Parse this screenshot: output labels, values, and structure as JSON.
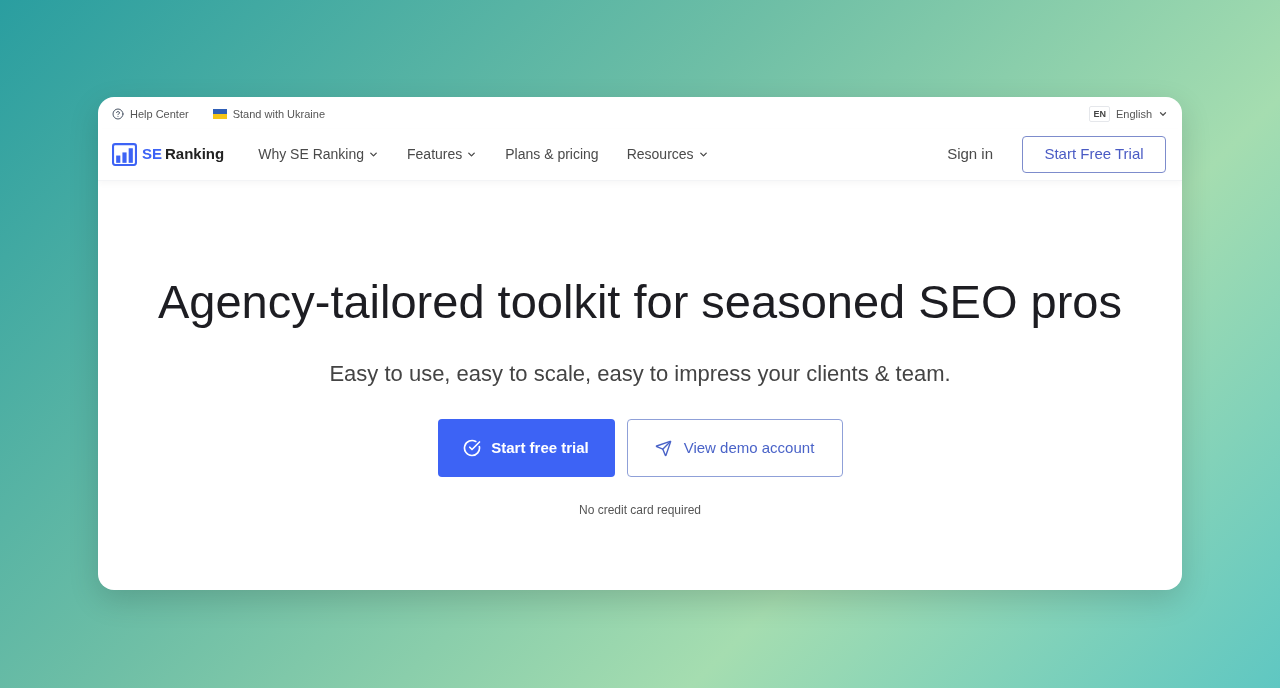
{
  "top_bar": {
    "links": [
      {
        "kind": "help",
        "label": "Help Center"
      },
      {
        "kind": "flag",
        "label": "Stand with Ukraine"
      }
    ],
    "language": {
      "code": "EN",
      "label": "English"
    }
  },
  "nav": {
    "logo": {
      "part_1": "SE",
      "part_2": "Ranking"
    },
    "items": [
      {
        "label": "Why SE Ranking",
        "dropdown": true
      },
      {
        "label": "Features",
        "dropdown": true
      },
      {
        "label": "Plans & pricing",
        "dropdown": false
      },
      {
        "label": "Resources",
        "dropdown": true
      }
    ],
    "sign_in": "Sign in",
    "cta": "Start Free Trial"
  },
  "hero": {
    "title": "Agency-tailored toolkit for seasoned SEO pros",
    "subtitle": "Easy to use, easy to scale, easy to impress your clients & team.",
    "buttons": [
      {
        "kind": "primary",
        "label": "Start free trial"
      },
      {
        "kind": "secondary",
        "label": "View demo account"
      }
    ],
    "note": "No credit card required"
  }
}
